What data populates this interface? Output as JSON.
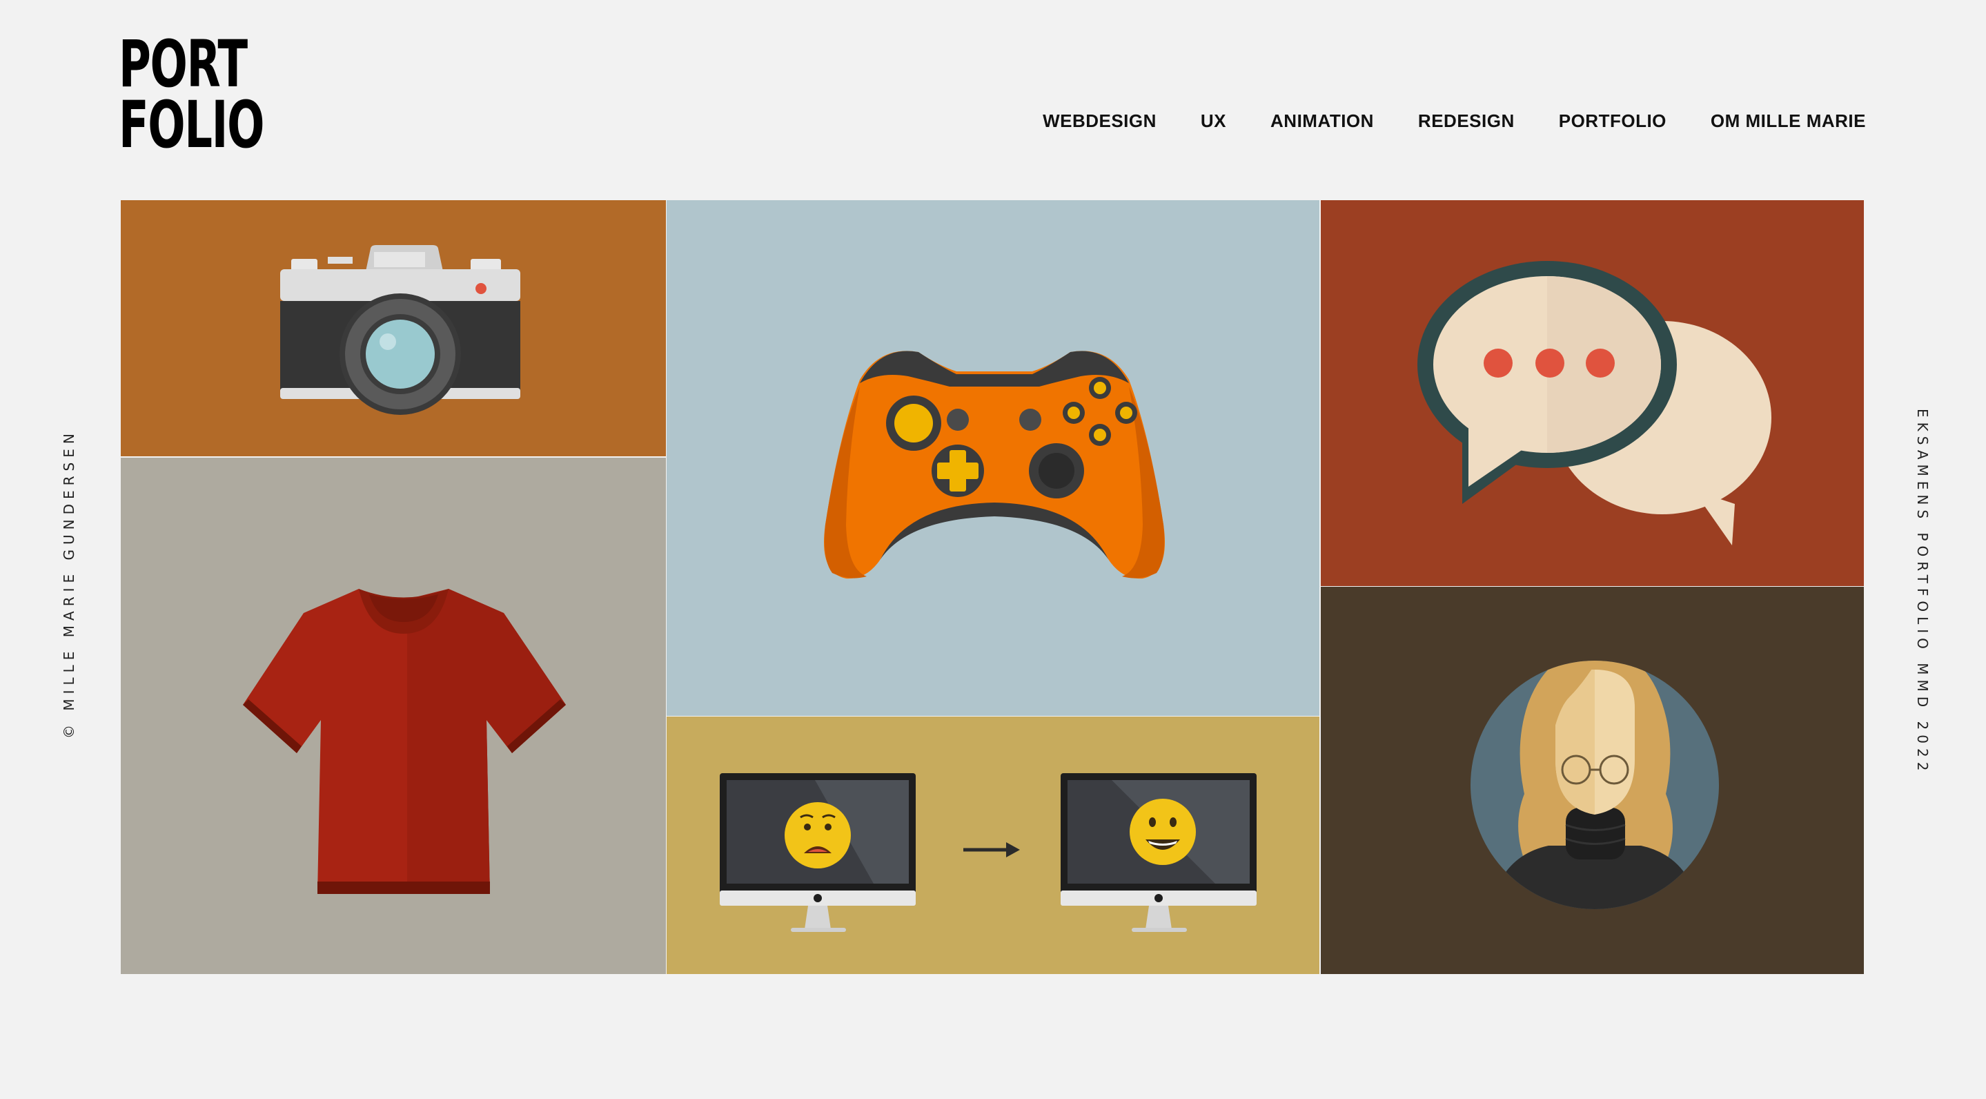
{
  "logo": {
    "line1": "PORT",
    "line2": "FOLIO"
  },
  "nav": {
    "items": [
      "WEBDESIGN",
      "UX",
      "ANIMATION",
      "REDESIGN",
      "PORTFOLIO",
      "OM MILLE MARIE"
    ]
  },
  "side": {
    "left": "© MILLE MARIE GUNDERSEN",
    "right": "EKSAMENS PORTFOLIO MMD 2022"
  },
  "tiles": {
    "camera": {
      "icon": "camera-icon",
      "color": "#b26a28"
    },
    "shirt": {
      "icon": "tshirt-icon",
      "color": "#aeaa9f"
    },
    "pad": {
      "icon": "game-controller-icon",
      "color": "#b0c5cc"
    },
    "monitor": {
      "icon": "monitor-sad-to-happy-icon",
      "color": "#c7ab5d"
    },
    "chat": {
      "icon": "chat-bubbles-icon",
      "color": "#9c3f22"
    },
    "avatar": {
      "icon": "avatar-portrait-icon",
      "color": "#4a3b2a"
    }
  }
}
